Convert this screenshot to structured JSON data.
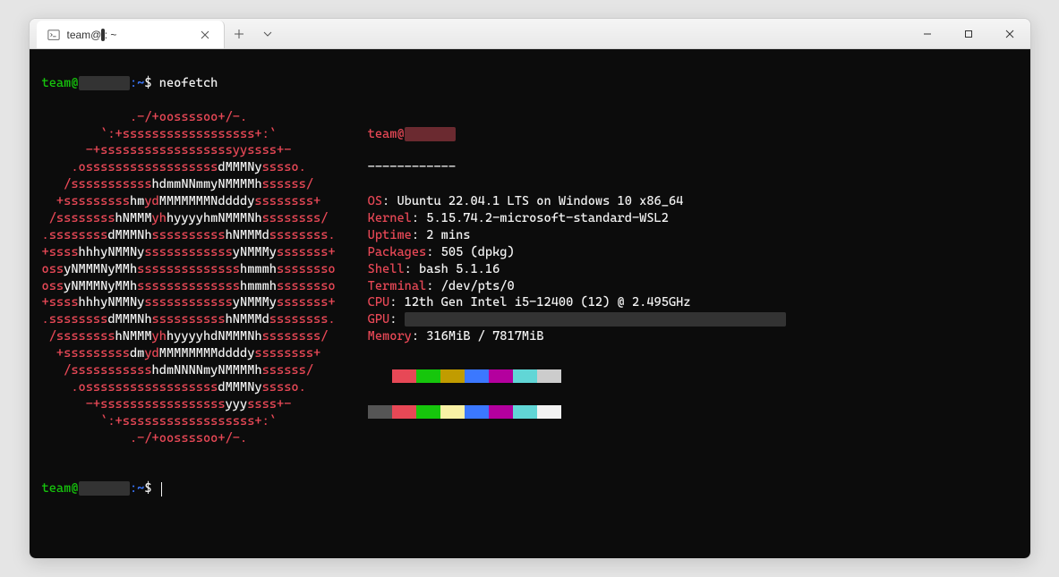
{
  "window": {
    "tab_title_prefix": "team@",
    "tab_title_suffix": ": ~",
    "redacted_host": "       "
  },
  "prompt": {
    "user": "team@",
    "host_redacted": "       ",
    "path": ":~",
    "symbol": "$",
    "command": "neofetch"
  },
  "logo_lines": [
    [
      {
        "c": "red",
        "t": "            .-/+oossssoo+/-."
      }
    ],
    [
      {
        "c": "red",
        "t": "        `:+ssssssssssssssssss+:`"
      }
    ],
    [
      {
        "c": "red",
        "t": "      -+ssssssssssssssssssyyssss+-"
      }
    ],
    [
      {
        "c": "red",
        "t": "    .ossssssssssssssssss"
      },
      {
        "c": "white",
        "t": "dMMMNy"
      },
      {
        "c": "red",
        "t": "sssso."
      }
    ],
    [
      {
        "c": "red",
        "t": "   /sssssssssss"
      },
      {
        "c": "white",
        "t": "hdmmNNmmyNMMMMh"
      },
      {
        "c": "red",
        "t": "ssssss/"
      }
    ],
    [
      {
        "c": "red",
        "t": "  +sssssssss"
      },
      {
        "c": "white",
        "t": "hm"
      },
      {
        "c": "red",
        "t": "yd"
      },
      {
        "c": "white",
        "t": "MMMMMMMNddddy"
      },
      {
        "c": "red",
        "t": "ssssssss+"
      }
    ],
    [
      {
        "c": "red",
        "t": " /ssssssss"
      },
      {
        "c": "white",
        "t": "hNMMM"
      },
      {
        "c": "red",
        "t": "yh"
      },
      {
        "c": "white",
        "t": "hyyyyhmNMMMNh"
      },
      {
        "c": "red",
        "t": "ssssssss/"
      }
    ],
    [
      {
        "c": "red",
        "t": ".ssssssss"
      },
      {
        "c": "white",
        "t": "dMMMNh"
      },
      {
        "c": "red",
        "t": "ssssssssss"
      },
      {
        "c": "white",
        "t": "hNMMMd"
      },
      {
        "c": "red",
        "t": "ssssssss."
      }
    ],
    [
      {
        "c": "red",
        "t": "+ssss"
      },
      {
        "c": "white",
        "t": "hhhyNMMNy"
      },
      {
        "c": "red",
        "t": "ssssssssssss"
      },
      {
        "c": "white",
        "t": "yNMMMy"
      },
      {
        "c": "red",
        "t": "sssssss+"
      }
    ],
    [
      {
        "c": "red",
        "t": "oss"
      },
      {
        "c": "white",
        "t": "yNMMMNyMMh"
      },
      {
        "c": "red",
        "t": "ssssssssssssss"
      },
      {
        "c": "white",
        "t": "hmmmh"
      },
      {
        "c": "red",
        "t": "ssssssso"
      }
    ],
    [
      {
        "c": "red",
        "t": "oss"
      },
      {
        "c": "white",
        "t": "yNMMMNyMMh"
      },
      {
        "c": "red",
        "t": "ssssssssssssss"
      },
      {
        "c": "white",
        "t": "hmmmh"
      },
      {
        "c": "red",
        "t": "ssssssso"
      }
    ],
    [
      {
        "c": "red",
        "t": "+ssss"
      },
      {
        "c": "white",
        "t": "hhhyNMMNy"
      },
      {
        "c": "red",
        "t": "ssssssssssss"
      },
      {
        "c": "white",
        "t": "yNMMMy"
      },
      {
        "c": "red",
        "t": "sssssss+"
      }
    ],
    [
      {
        "c": "red",
        "t": ".ssssssss"
      },
      {
        "c": "white",
        "t": "dMMMNh"
      },
      {
        "c": "red",
        "t": "ssssssssss"
      },
      {
        "c": "white",
        "t": "hNMMMd"
      },
      {
        "c": "red",
        "t": "ssssssss."
      }
    ],
    [
      {
        "c": "red",
        "t": " /ssssssss"
      },
      {
        "c": "white",
        "t": "hNMMM"
      },
      {
        "c": "red",
        "t": "yh"
      },
      {
        "c": "white",
        "t": "hyyyyhdNMMMNh"
      },
      {
        "c": "red",
        "t": "ssssssss/"
      }
    ],
    [
      {
        "c": "red",
        "t": "  +sssssssss"
      },
      {
        "c": "white",
        "t": "dm"
      },
      {
        "c": "red",
        "t": "yd"
      },
      {
        "c": "white",
        "t": "MMMMMMMMddddy"
      },
      {
        "c": "red",
        "t": "ssssssss+"
      }
    ],
    [
      {
        "c": "red",
        "t": "   /sssssssssss"
      },
      {
        "c": "white",
        "t": "hdmNNNNmyNMMMMh"
      },
      {
        "c": "red",
        "t": "ssssss/"
      }
    ],
    [
      {
        "c": "red",
        "t": "    .ossssssssssssssssss"
      },
      {
        "c": "white",
        "t": "dMMMNy"
      },
      {
        "c": "red",
        "t": "sssso."
      }
    ],
    [
      {
        "c": "red",
        "t": "      -+sssssssssssssssss"
      },
      {
        "c": "white",
        "t": "yyy"
      },
      {
        "c": "red",
        "t": "ssss+-"
      }
    ],
    [
      {
        "c": "red",
        "t": "        `:+ssssssssssssssssss+:`"
      }
    ],
    [
      {
        "c": "red",
        "t": "            .-/+oossssoo+/-."
      }
    ]
  ],
  "info": {
    "header_user": "team@",
    "header_host_redacted": "       ",
    "separator": "------------",
    "lines": [
      {
        "label": "OS",
        "value": "Ubuntu 22.04.1 LTS on Windows 10 x86_64"
      },
      {
        "label": "Kernel",
        "value": "5.15.74.2-microsoft-standard-WSL2"
      },
      {
        "label": "Uptime",
        "value": "2 mins"
      },
      {
        "label": "Packages",
        "value": "505 (dpkg)"
      },
      {
        "label": "Shell",
        "value": "bash 5.1.16"
      },
      {
        "label": "Terminal",
        "value": "/dev/pts/0"
      },
      {
        "label": "CPU",
        "value": "12th Gen Intel i5-12400 (12) @ 2.495GHz"
      },
      {
        "label": "GPU",
        "value": "",
        "redacted": true
      },
      {
        "label": "Memory",
        "value": "316MiB / 7817MiB"
      }
    ]
  },
  "prompt2": {
    "user": "team@",
    "host_redacted": "       ",
    "path": ":~",
    "symbol": "$"
  }
}
